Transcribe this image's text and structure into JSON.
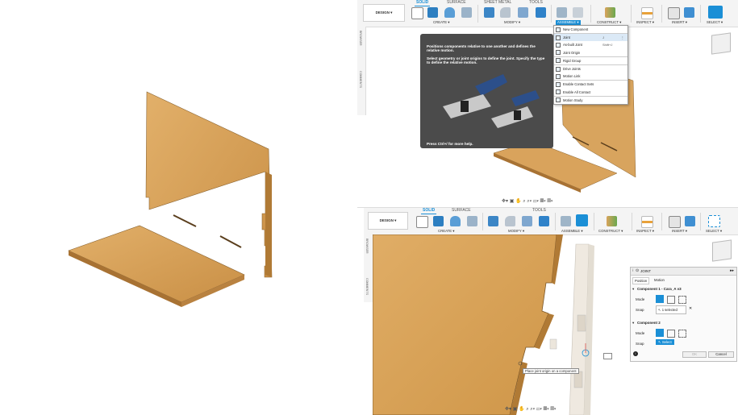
{
  "top": {
    "design_label": "DESIGN ▾",
    "tabs": [
      "SOLID",
      "SURFACE",
      "SHEET METAL",
      "TOOLS"
    ],
    "groups": {
      "create": "CREATE ▾",
      "modify": "MODIFY ▾",
      "assemble": "ASSEMBLE ▾",
      "construct": "CONSTRUCT ▾",
      "inspect": "INSPECT ▾",
      "insert": "INSERT ▾",
      "select": "SELECT ▾"
    },
    "side_browser": "BROWSER",
    "side_comments": "COMMENTS"
  },
  "assemble_menu": [
    {
      "label": "New Component",
      "shortcut": ""
    },
    {
      "label": "Joint",
      "shortcut": "J"
    },
    {
      "label": "As-built Joint",
      "shortcut": "Shift+J"
    },
    {
      "label": "Joint Origin",
      "shortcut": ""
    },
    {
      "label": "Rigid Group",
      "shortcut": ""
    },
    {
      "label": "Drive Joints",
      "shortcut": ""
    },
    {
      "label": "Motion Link",
      "shortcut": ""
    },
    {
      "label": "Enable Contact Sets",
      "shortcut": ""
    },
    {
      "label": "Enable All Contact",
      "shortcut": ""
    },
    {
      "label": "Motion Study",
      "shortcut": ""
    }
  ],
  "tooltip": {
    "heading": "Positions components relative to one another and defines the relative motion.",
    "body": "Select geometry or joint origins to define the joint. Specify the type to define the relative motion.",
    "footer": "Press Ctrl+/ for more help."
  },
  "bottom": {
    "design_label": "DESIGN ▾",
    "tabs": [
      "SOLID",
      "SURFACE",
      "TOOLS"
    ],
    "groups": {
      "create": "CREATE ▾",
      "modify": "MODIFY ▾",
      "assemble": "ASSEMBLE ▾",
      "construct": "CONSTRUCT ▾",
      "inspect": "INSPECT ▾",
      "insert": "INSERT ▾",
      "select": "SELECT ▾"
    },
    "side_browser": "BROWSER",
    "side_comments": "COMMENTS",
    "viewport_hint": "Place joint origin on a component"
  },
  "joint_panel": {
    "title": "JOINT",
    "tabs": [
      "Position",
      "Motion"
    ],
    "component1_title": "Component 1 - Cara_A v3",
    "component2_title": "Component 2",
    "mode_label": "Mode",
    "snap_label": "Snap",
    "snap1_value": "1 selected",
    "snap2_value": "Select",
    "ok_label": "OK",
    "cancel_label": "Cancel"
  },
  "colors": {
    "accent": "#1b8fd6",
    "wood": "#d9a35c",
    "wood_dark": "#b88440"
  }
}
